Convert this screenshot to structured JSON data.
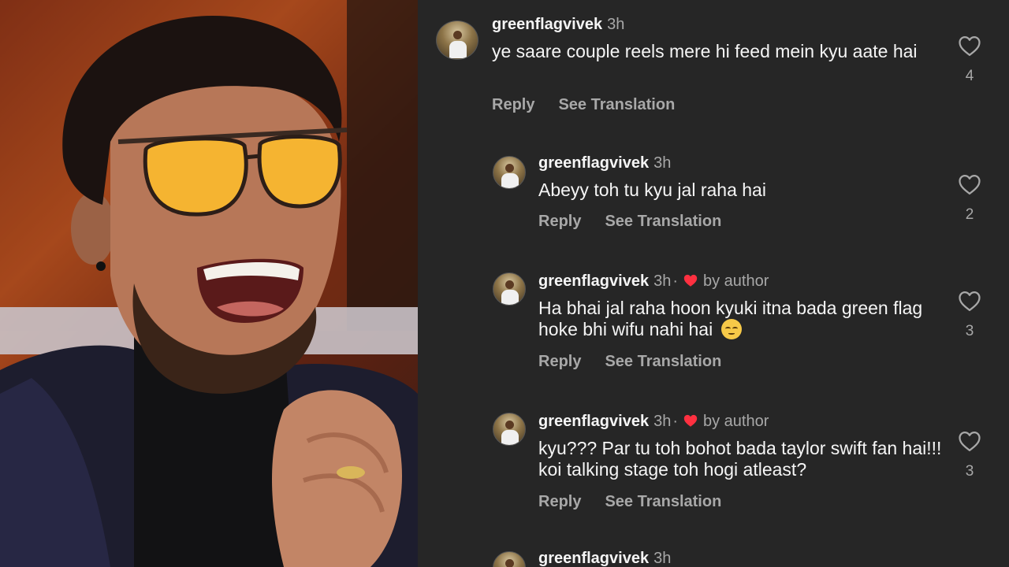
{
  "comments": [
    {
      "username": "greenflagvivek",
      "time": "3h",
      "by_author": false,
      "text": "ye saare couple reels mere hi feed mein kyu aate hai",
      "reply_label": "Reply",
      "translate_label": "See Translation",
      "likes": "4"
    },
    {
      "username": "greenflagvivek",
      "time": "3h",
      "by_author": false,
      "text": "Abeyy toh tu kyu jal raha hai",
      "reply_label": "Reply",
      "translate_label": "See Translation",
      "likes": "2"
    },
    {
      "username": "greenflagvivek",
      "time": "3h",
      "by_author": true,
      "dot": "·",
      "author_label": "by author",
      "text": "Ha bhai jal raha hoon kyuki itna bada green flag hoke bhi wifu nahi hai",
      "emoji": "pensive-face",
      "reply_label": "Reply",
      "translate_label": "See Translation",
      "likes": "3"
    },
    {
      "username": "greenflagvivek",
      "time": "3h",
      "by_author": true,
      "dot": "·",
      "author_label": "by author",
      "text": "kyu??? Par tu toh bohot bada taylor swift fan hai!!! koi talking stage toh hogi atleast?",
      "reply_label": "Reply",
      "translate_label": "See Translation",
      "likes": "3"
    },
    {
      "username": "greenflagvivek",
      "time": "3h"
    }
  ],
  "icons": {
    "like": "heart-outline-icon",
    "author_like": "heart-filled-icon"
  },
  "colors": {
    "background": "#262626",
    "text": "#f5f5f5",
    "muted": "#a8a8a8",
    "heart_red": "#ff3040"
  }
}
